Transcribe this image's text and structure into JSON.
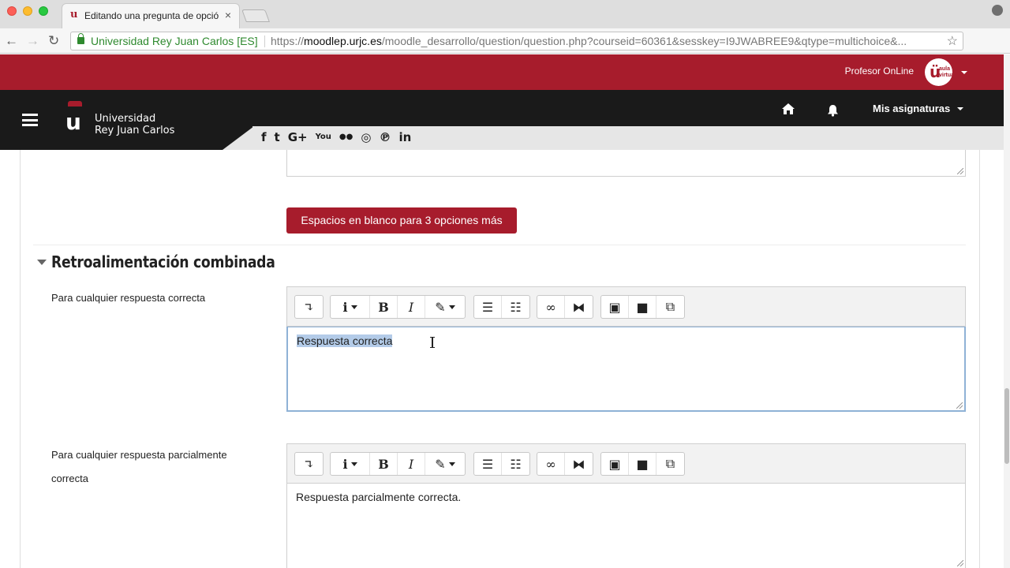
{
  "browser": {
    "tab_title": "Editando una pregunta de opción múltiple",
    "tab_close": "×",
    "site_identity": "Universidad Rey Juan Carlos [ES]",
    "url_scheme": "https://",
    "url_host": "moodlep.urjc.es",
    "url_path": "/moodle_desarrollo/question/question.php?courseid=60361&sesskey=I9JWABREE9&qtype=multichoice&...",
    "nav_back": "←",
    "nav_forward": "→",
    "nav_reload": "↻",
    "bookmark": "☆",
    "menu": "⋮"
  },
  "header": {
    "profile_name": "Profesor OnLine",
    "avatar_text": "aula virtual",
    "avatar_letter": "ü",
    "logo_letter": "u",
    "logo_line1": "Universidad",
    "logo_line2": "Rey Juan Carlos",
    "courses_menu": "Mis asignaturas",
    "social": [
      "f",
      "t",
      "G+",
      "You",
      "●●",
      "◎",
      "℗",
      "in"
    ]
  },
  "form": {
    "blank_button": "Espacios en blanco para 3 opciones más",
    "section_title": "Retroalimentación combinada",
    "fields": [
      {
        "label": "Para cualquier respuesta correcta",
        "value": "Respuesta correcta"
      },
      {
        "label": "Para cualquier respuesta parcialmente correcta",
        "value": "Respuesta parcialmente correcta."
      }
    ],
    "toolbar": {
      "undo": "↴",
      "info": "i",
      "bold": "B",
      "italic": "I",
      "style": "✎",
      "bullets": "☰",
      "numbers": "☷",
      "link": "∞",
      "unlink": "⧓",
      "image": "▣",
      "video": "■",
      "copy": "⧉"
    }
  }
}
